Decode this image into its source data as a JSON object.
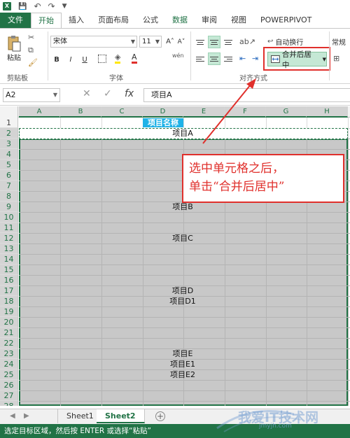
{
  "qat": {
    "logo": "X",
    "save": "💾",
    "undo": "↶",
    "redo": "↷",
    "filter": "▼"
  },
  "tabs": [
    "文件",
    "开始",
    "插入",
    "页面布局",
    "公式",
    "数据",
    "审阅",
    "视图",
    "POWERPIVOT"
  ],
  "active_tab": "开始",
  "ribbon": {
    "clipboard": {
      "paste": "粘贴",
      "label": "剪贴板"
    },
    "font": {
      "name": "宋体",
      "size": "11",
      "bold": "B",
      "italic": "I",
      "underline": "U",
      "grow": "A˄",
      "shrink": "A˅",
      "label": "字体",
      "wen": "wén",
      "font_color": "A"
    },
    "alignment": {
      "wrap": "自动换行",
      "merge": "合并后居中",
      "label": "对齐方式"
    },
    "number": {
      "format": "常规"
    }
  },
  "formula_bar": {
    "name_box": "A2",
    "cancel": "✕",
    "confirm": "✓",
    "fx": "fx",
    "content": "项目A"
  },
  "columns": [
    "A",
    "B",
    "C",
    "D",
    "E",
    "F",
    "G",
    "H"
  ],
  "rows": [
    "1",
    "2",
    "3",
    "4",
    "5",
    "6",
    "7",
    "8",
    "9",
    "10",
    "11",
    "12",
    "13",
    "14",
    "15",
    "16",
    "17",
    "18",
    "19",
    "20",
    "21",
    "22",
    "23",
    "24",
    "25",
    "26",
    "27",
    "28"
  ],
  "cells": {
    "header": "项目名称",
    "r2": "项目A",
    "r9": "项目B",
    "r12": "项目C",
    "r17": "项目D",
    "r18": "项目D1",
    "r23": "项目E",
    "r24": "项目E1",
    "r25": "项目E2"
  },
  "callout": {
    "line1": "选中单元格之后，",
    "line2": "单击“合并后居中”"
  },
  "sheets": [
    "Sheet1",
    "Sheet2"
  ],
  "active_sheet": "Sheet2",
  "add_sheet": "+",
  "status": "选定目标区域，然后按 ENTER 或选择“粘贴”",
  "watermark": {
    "text": "我爱IT技术网",
    "url": "jmyjh.com"
  },
  "colors": {
    "excel_green": "#217346",
    "header_blue": "#1fb2e7",
    "callout_red": "#e0302c",
    "selection_gray": "#c8c8c8"
  }
}
